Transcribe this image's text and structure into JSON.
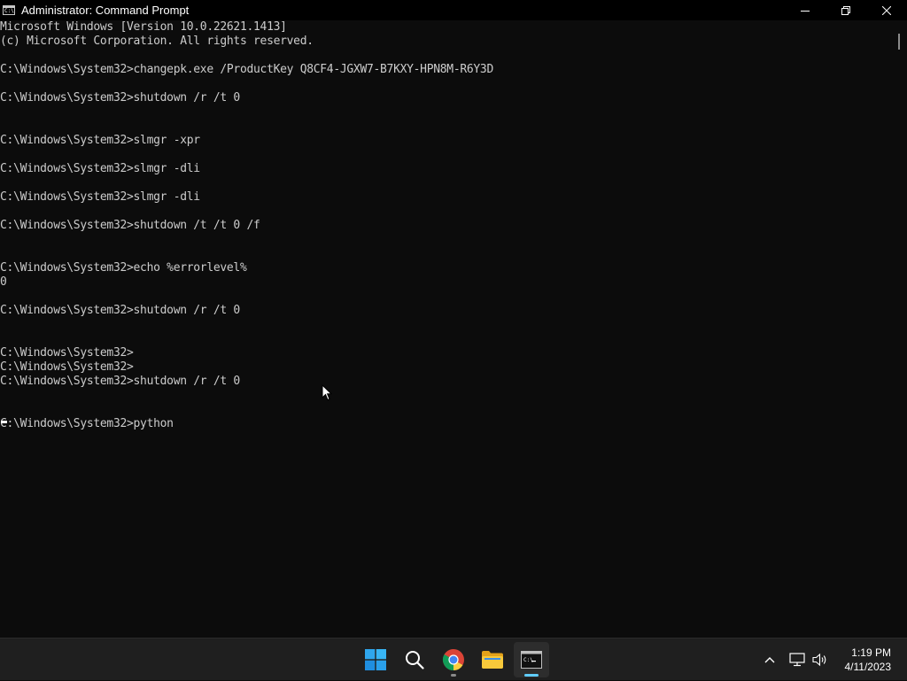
{
  "window": {
    "title": "Administrator: Command Prompt",
    "icon_text": "C:\\"
  },
  "console": {
    "lines": [
      "Microsoft Windows [Version 10.0.22621.1413]",
      "(c) Microsoft Corporation. All rights reserved.",
      "",
      "C:\\Windows\\System32>changepk.exe /ProductKey Q8CF4-JGXW7-B7KXY-HPN8M-R6Y3D",
      "",
      "C:\\Windows\\System32>shutdown /r /t 0",
      "",
      "",
      "C:\\Windows\\System32>slmgr -xpr",
      "",
      "C:\\Windows\\System32>slmgr -dli",
      "",
      "C:\\Windows\\System32>slmgr -dli",
      "",
      "C:\\Windows\\System32>shutdown /t /t 0 /f",
      "",
      "",
      "C:\\Windows\\System32>echo %errorlevel%",
      "0",
      "",
      "C:\\Windows\\System32>shutdown /r /t 0",
      "",
      "",
      "C:\\Windows\\System32>",
      "C:\\Windows\\System32>",
      "C:\\Windows\\System32>shutdown /r /t 0",
      "",
      "",
      "C:\\Windows\\System32>python"
    ]
  },
  "taskbar": {
    "apps": [
      {
        "name": "start",
        "icon": "windows-logo-icon",
        "running": false,
        "active": false
      },
      {
        "name": "search",
        "icon": "search-icon",
        "running": false,
        "active": false
      },
      {
        "name": "chrome",
        "icon": "chrome-icon",
        "running": true,
        "active": false
      },
      {
        "name": "file-explorer",
        "icon": "folder-icon",
        "running": false,
        "active": false
      },
      {
        "name": "command-prompt",
        "icon": "terminal-icon",
        "running": true,
        "active": true
      }
    ],
    "tray": {
      "icons": [
        "chevron-up-icon",
        "network-icon",
        "volume-icon"
      ]
    },
    "clock": {
      "time": "1:19 PM",
      "date": "4/11/2023"
    }
  },
  "colors": {
    "console_bg": "#0c0c0c",
    "console_text": "#cccccc",
    "taskbar_bg": "#1f1f1f",
    "accent": "#60cdff"
  }
}
